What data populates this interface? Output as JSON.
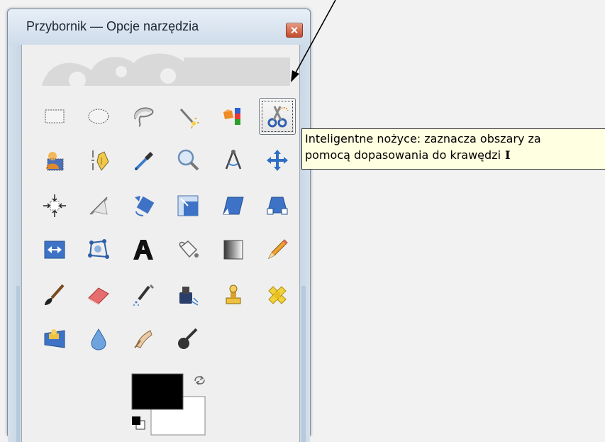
{
  "window": {
    "title": "Przybornik — Opcje narzędzia"
  },
  "tools": [
    {
      "name": "rect-select-icon",
      "label": "Zaznaczenie prostokątne"
    },
    {
      "name": "ellipse-select-icon",
      "label": "Zaznaczenie eliptyczne"
    },
    {
      "name": "free-select-icon",
      "label": "Zaznaczenie odręczne"
    },
    {
      "name": "fuzzy-select-icon",
      "label": "Różdżka"
    },
    {
      "name": "select-by-color-icon",
      "label": "Zaznaczenie według koloru"
    },
    {
      "name": "scissors-icon",
      "label": "Inteligentne nożyce",
      "active": true
    },
    {
      "name": "foreground-select-icon",
      "label": "Zaznaczenie pierwszego planu"
    },
    {
      "name": "paths-icon",
      "label": "Ścieżki"
    },
    {
      "name": "color-picker-icon",
      "label": "Pipeta"
    },
    {
      "name": "zoom-icon",
      "label": "Powiększenie"
    },
    {
      "name": "measure-icon",
      "label": "Miarka"
    },
    {
      "name": "move-icon",
      "label": "Przesunięcie"
    },
    {
      "name": "align-icon",
      "label": "Wyrównanie"
    },
    {
      "name": "crop-icon",
      "label": "Kadrowanie"
    },
    {
      "name": "rotate-icon",
      "label": "Obrót"
    },
    {
      "name": "scale-icon",
      "label": "Skalowanie"
    },
    {
      "name": "shear-icon",
      "label": "Pochylenie"
    },
    {
      "name": "perspective-icon",
      "label": "Perspektywa"
    },
    {
      "name": "flip-icon",
      "label": "Odbicie"
    },
    {
      "name": "cage-transform-icon",
      "label": "Przekształcenie klatki"
    },
    {
      "name": "text-icon",
      "label": "Tekst"
    },
    {
      "name": "bucket-fill-icon",
      "label": "Wypełnienie kubełkiem"
    },
    {
      "name": "blend-icon",
      "label": "Gradient"
    },
    {
      "name": "pencil-icon",
      "label": "Ołówek"
    },
    {
      "name": "paintbrush-icon",
      "label": "Pędzel"
    },
    {
      "name": "eraser-icon",
      "label": "Gumka"
    },
    {
      "name": "airbrush-icon",
      "label": "Aerograf"
    },
    {
      "name": "ink-icon",
      "label": "Atrament"
    },
    {
      "name": "clone-icon",
      "label": "Klonowanie"
    },
    {
      "name": "heal-icon",
      "label": "Leczenie"
    },
    {
      "name": "perspective-clone-icon",
      "label": "Klonowanie perspektywy"
    },
    {
      "name": "blur-sharpen-icon",
      "label": "Rozmycie"
    },
    {
      "name": "smudge-icon",
      "label": "Smużenie"
    },
    {
      "name": "dodge-burn-icon",
      "label": "Rozjaśnianie"
    }
  ],
  "tooltip": {
    "line1": "Inteligentne nożyce: zaznacza obszary za",
    "line2": "pomocą dopasowania do krawędzi",
    "shortcut": "I"
  },
  "colors": {
    "foreground": "#000000",
    "background": "#ffffff"
  }
}
